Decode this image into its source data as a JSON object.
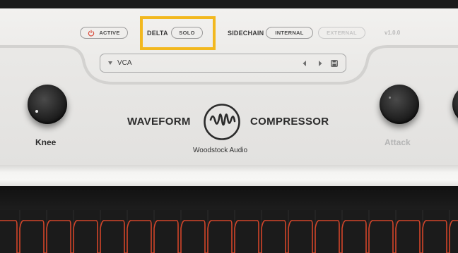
{
  "header": {
    "active_label": "ACTIVE",
    "delta_label": "DELTA",
    "solo_label": "SOLO",
    "sidechain_label": "SIDECHAIN",
    "internal_label": "INTERNAL",
    "external_label": "EXTERNAL",
    "version": "v1.0.0"
  },
  "preset": {
    "name": "VCA"
  },
  "knobs": {
    "left_label": "Knee",
    "right_label": "Attack"
  },
  "brand": {
    "left_word": "WAVEFORM",
    "right_word": "COMPRESSOR",
    "maker": "Woodstock Audio"
  },
  "colors": {
    "highlight": "#f2b81f",
    "power": "#d94a3a",
    "waveform": "#d2452a"
  },
  "icons": {
    "power": "power-icon",
    "preset_dropdown": "chevron-down-icon",
    "prev": "chevron-left-icon",
    "next": "chevron-right-icon",
    "save": "save-icon",
    "logo": "waveform-logo-icon"
  }
}
